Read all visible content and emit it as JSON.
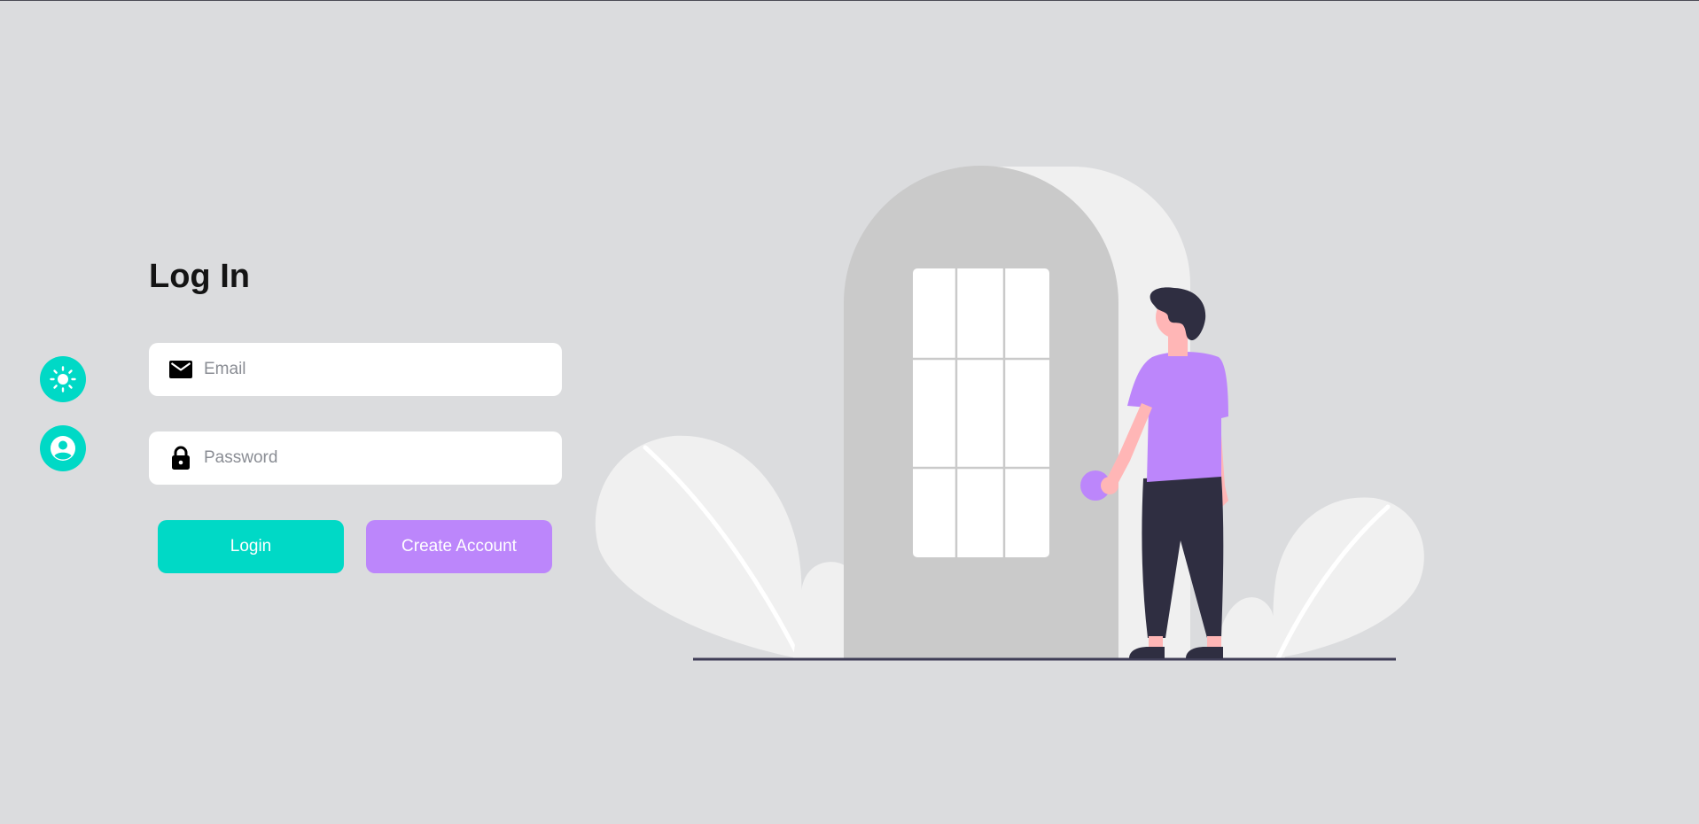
{
  "sidebar": {
    "theme_toggle_icon": "sun-icon",
    "profile_icon": "user-circle-icon"
  },
  "form": {
    "title": "Log In",
    "email": {
      "placeholder": "Email",
      "value": "",
      "icon": "envelope-icon"
    },
    "password": {
      "placeholder": "Password",
      "value": "",
      "icon": "lock-icon"
    },
    "login_label": "Login",
    "create_label": "Create Account"
  },
  "colors": {
    "background": "#dbdcde",
    "accent_teal": "#00d9c6",
    "accent_purple": "#bc86fb",
    "ink": "#2f2e41",
    "skin": "#ffb6b6"
  }
}
